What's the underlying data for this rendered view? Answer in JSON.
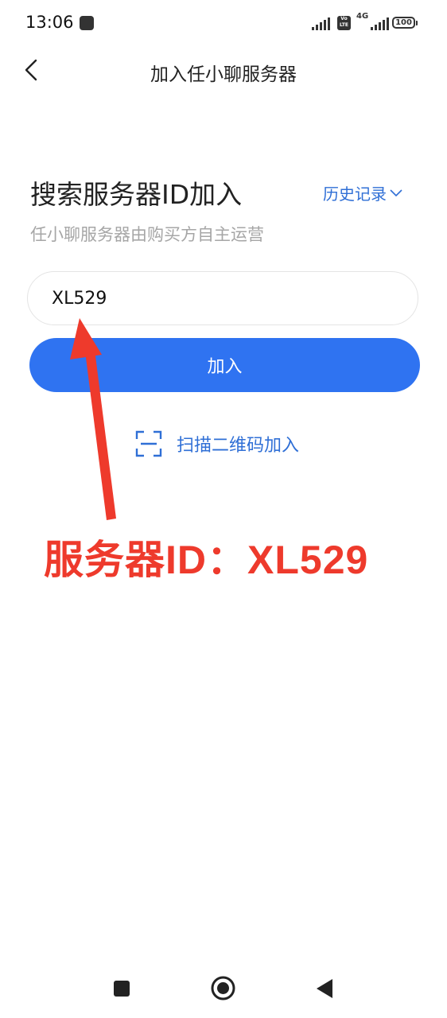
{
  "status_bar": {
    "time": "13:06",
    "network": "4G",
    "volte_label": "Vo LTE",
    "battery": "100"
  },
  "header": {
    "title": "加入任小聊服务器"
  },
  "main": {
    "heading": "搜索服务器ID加入",
    "history_label": "历史记录",
    "subheading": "任小聊服务器由购买方自主运营",
    "server_id_input": {
      "value": "XL529"
    },
    "join_button": "加入",
    "scan_label": "扫描二维码加入"
  },
  "annotation": {
    "text": "服务器ID：XL529"
  },
  "colors": {
    "accent": "#2f73f1",
    "link": "#2f6fd6",
    "annotation_red": "#ee3a2c"
  },
  "icons": [
    "back-arrow-icon",
    "chevron-down-icon",
    "scan-qr-icon",
    "nav-recents-icon",
    "nav-home-icon",
    "nav-back-icon"
  ]
}
